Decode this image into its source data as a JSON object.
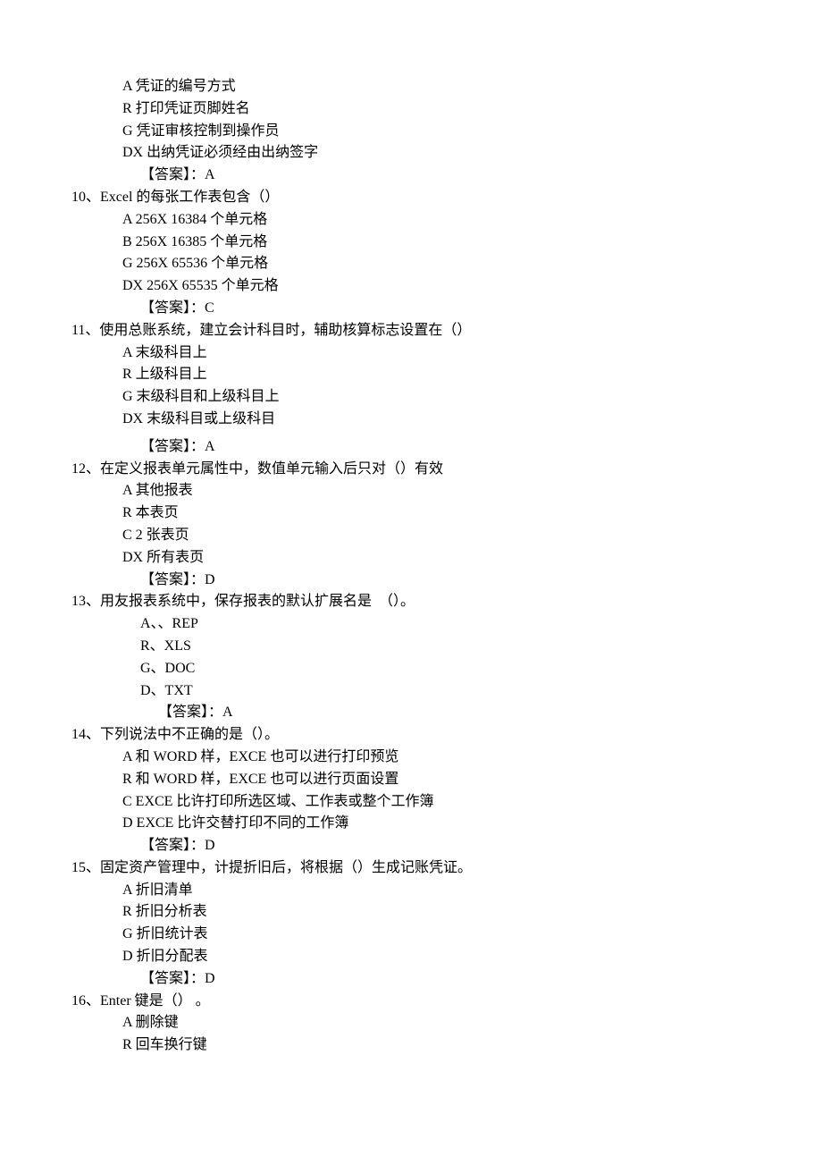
{
  "q9": {
    "optA": "A 凭证的编号方式",
    "optB": "R 打印凭证页脚姓名",
    "optC": "G 凭证审核控制到操作员",
    "optD": "DX 出纳凭证必须经由出纳签字",
    "answer": "【答案】：A"
  },
  "q10": {
    "stem": "10、Excel 的每张工作表包含（）",
    "optA": "A 256X 16384 个单元格",
    "optB": "B 256X 16385 个单元格",
    "optC": "G 256X 65536 个单元格",
    "optD": "DX 256X 65535 个单元格",
    "answer": "【答案】：C"
  },
  "q11": {
    "stem": "11、使用总账系统，建立会计科目时，辅助核算标志设置在（）",
    "optA": "A 末级科目上",
    "optB": "R 上级科目上",
    "optC": "G 末级科目和上级科目上",
    "optD": "DX 末级科目或上级科目",
    "answer": "【答案】：A"
  },
  "q12": {
    "stem": "12、在定义报表单元属性中，数值单元输入后只对（）有效",
    "optA": "A 其他报表",
    "optB": "R 本表页",
    "optC": "C 2 张表页",
    "optD": "DX 所有表页",
    "answer": "【答案】：D"
  },
  "q13": {
    "stem": "13、用友报表系统中，保存报表的默认扩展名是  （）。",
    "optA": "A、、REP",
    "optB": "R、XLS",
    "optC": "G、DOC",
    "optD": "D、TXT",
    "answer": "【答案】：A"
  },
  "q14": {
    "stem": "14、下列说法中不正确的是（）。",
    "optA": "A 和 WORD 样，EXCE 也可以进行打印预览",
    "optB": "R 和 WORD 样，EXCE 也可以进行页面设置",
    "optC": "C EXCE 比许打印所选区域、工作表或整个工作簿",
    "optD": "D EXCE 比许交替打印不同的工作簿",
    "answer": "【答案】：D"
  },
  "q15": {
    "stem": "15、固定资产管理中，计提折旧后，将根据（）生成记账凭证。",
    "optA": "A 折旧清单",
    "optB": "R 折旧分析表",
    "optC": "G 折旧统计表",
    "optD": "D 折旧分配表",
    "answer": "【答案】：D"
  },
  "q16": {
    "stem": "16、Enter 键是（） 。",
    "optA": "A 删除键",
    "optB": "R 回车换行键"
  }
}
